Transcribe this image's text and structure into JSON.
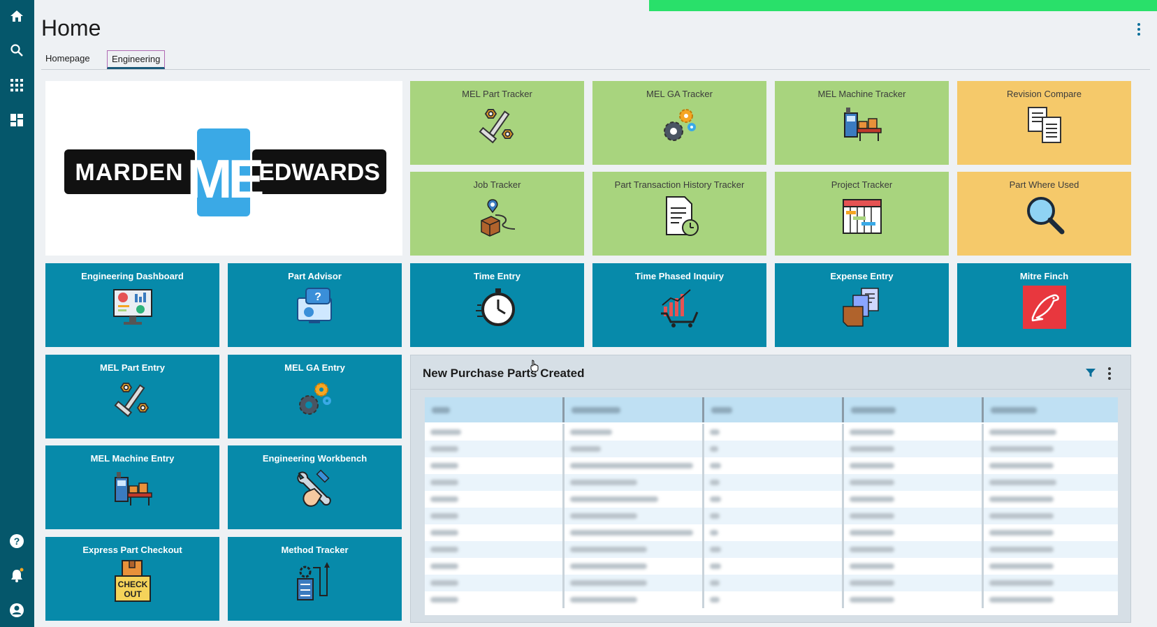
{
  "page": {
    "title": "Home"
  },
  "tabs": [
    {
      "label": "Homepage",
      "active": false
    },
    {
      "label": "Engineering",
      "active": true
    }
  ],
  "rail_icons": {
    "top": [
      "home-icon",
      "search-icon",
      "apps-grid-icon",
      "dashboard-icon"
    ],
    "bottom": [
      "help-icon",
      "notifications-icon",
      "account-icon"
    ]
  },
  "logo": {
    "left": "MARDEN",
    "mid": "ME",
    "right": "EDWARDS"
  },
  "tiles": {
    "mel_part_tracker": "MEL Part Tracker",
    "mel_ga_tracker": "MEL GA Tracker",
    "mel_machine_tracker": "MEL Machine Tracker",
    "revision_compare": "Revision Compare",
    "job_tracker": "Job Tracker",
    "part_transaction_history_tracker": "Part Transaction History Tracker",
    "project_tracker": "Project Tracker",
    "part_where_used": "Part Where Used",
    "engineering_dashboard": "Engineering Dashboard",
    "part_advisor": "Part Advisor",
    "time_entry": "Time Entry",
    "time_phased_inquiry": "Time Phased Inquiry",
    "expense_entry": "Expense Entry",
    "mitre_finch": "Mitre Finch",
    "mel_part_entry": "MEL Part Entry",
    "mel_ga_entry": "MEL GA Entry",
    "mel_machine_entry": "MEL Machine Entry",
    "engineering_workbench": "Engineering Workbench",
    "express_part_checkout": "Express Part Checkout",
    "method_tracker": "Method Tracker"
  },
  "checkout_icon_text": {
    "line1": "CHECK",
    "line2": "OUT"
  },
  "panel": {
    "title": "New Purchase Parts Created"
  },
  "colors": {
    "rail": "#05576b",
    "tile_green": "#a8d47e",
    "tile_yellow": "#f5c96a",
    "tile_blue": "#078aaa",
    "status_strip": "#29e06a"
  }
}
